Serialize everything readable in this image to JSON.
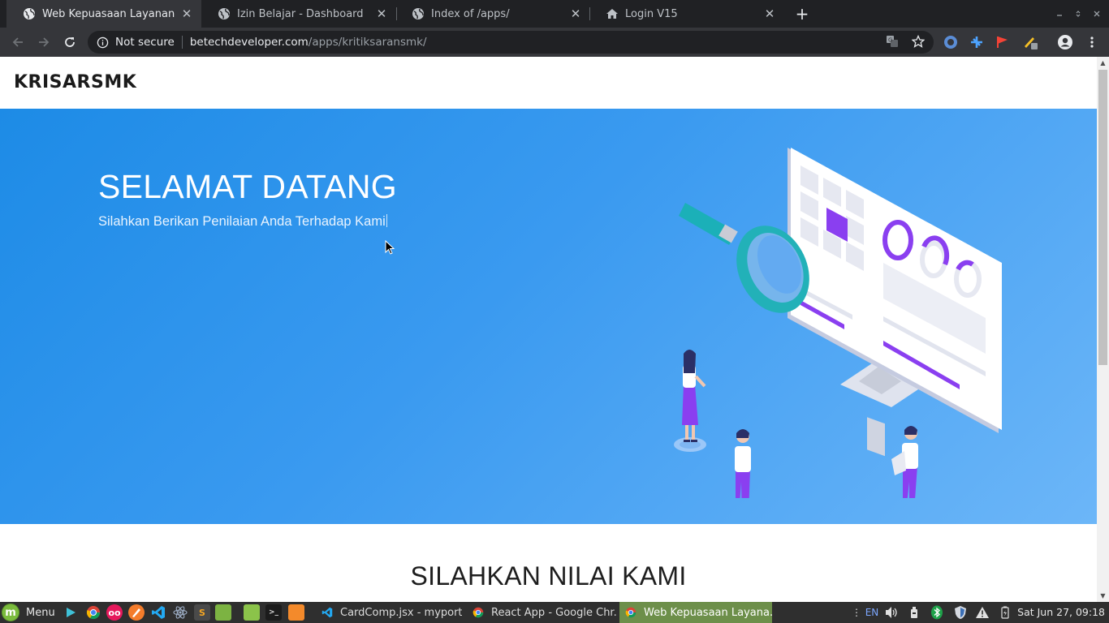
{
  "browser": {
    "tabs": [
      {
        "title": "Web Kepuasaan Layanan SMK",
        "icon": "globe-icon",
        "active": true
      },
      {
        "title": "Izin Belajar - Dashboard",
        "icon": "globe-icon",
        "active": false
      },
      {
        "title": "Index of /apps/",
        "icon": "globe-icon",
        "active": false
      },
      {
        "title": "Login V15",
        "icon": "home-icon",
        "active": false
      }
    ],
    "new_tab_label": "+",
    "security_label": "Not secure",
    "url_host": "betechdeveloper.com",
    "url_path": "/apps/kritiksaransmk/"
  },
  "page": {
    "brand": "KRISARSMK",
    "hero": {
      "title": "SELAMAT DATANG",
      "subtitle": "Silahkan Berikan Penilaian Anda Terhadap Kami"
    },
    "section_title": "SILAHKAN NILAI KAMI"
  },
  "taskbar": {
    "menu_label": "Menu",
    "launchers": [
      "terminal-icon",
      "chrome-icon",
      "flickr-icon",
      "sublime-icon",
      "vscode-icon",
      "react-icon",
      "sublime-s-icon",
      "files-icon",
      "folder-icon",
      "console-icon",
      "app-icon"
    ],
    "windows": [
      {
        "title": "CardComp.jsx - myport...",
        "icon": "vscode-icon",
        "active": false
      },
      {
        "title": "React App - Google Chr...",
        "icon": "chrome-icon",
        "active": false
      },
      {
        "title": "Web Kepuasaan Layana...",
        "icon": "chrome-icon",
        "active": true
      }
    ],
    "keyboard_layout": "EN",
    "clock": "Sat Jun 27, 09:18"
  },
  "colors": {
    "hero_start": "#1d8be6",
    "hero_end": "#6cb6f8",
    "accent_purple": "#8a3ff0",
    "accent_teal": "#22b1b8",
    "taskbar_active": "#6d8f4a"
  }
}
